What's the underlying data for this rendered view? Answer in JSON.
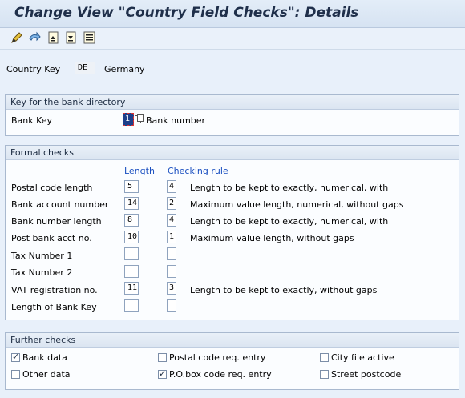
{
  "title": "Change View \"Country Field Checks\": Details",
  "toolbar": [
    {
      "icon": "edit-pen-icon"
    },
    {
      "icon": "other-entry-icon"
    },
    {
      "icon": "first-entry-icon"
    },
    {
      "icon": "previous-entry-icon"
    },
    {
      "icon": "next-entry-icon"
    }
  ],
  "country": {
    "label": "Country Key",
    "value": "DE",
    "name": "Germany"
  },
  "bank_directory": {
    "header": "Key for the bank directory",
    "bank_key_label": "Bank Key",
    "bank_key_value": "1",
    "bank_key_text": "Bank number"
  },
  "formal_checks": {
    "header": "Formal checks",
    "col_length": "Length",
    "col_rule": "Checking rule",
    "rows": [
      {
        "label": "Postal code length",
        "length": "5",
        "rule": "4",
        "desc": "Length to be kept to exactly, numerical, with"
      },
      {
        "label": "Bank account number",
        "length": "14",
        "rule": "2",
        "desc": "Maximum value length, numerical, without gaps"
      },
      {
        "label": "Bank number length",
        "length": "8",
        "rule": "4",
        "desc": "Length to be kept to exactly, numerical, with"
      },
      {
        "label": "Post bank acct no.",
        "length": "10",
        "rule": "1",
        "desc": "Maximum value length, without gaps"
      },
      {
        "label": "Tax Number 1",
        "length": "",
        "rule": "",
        "desc": ""
      },
      {
        "label": "Tax Number 2",
        "length": "",
        "rule": "",
        "desc": ""
      },
      {
        "label": "VAT registration no.",
        "length": "11",
        "rule": "3",
        "desc": "Length to be kept to exactly, without gaps"
      },
      {
        "label": "Length of Bank Key",
        "length": "",
        "rule": "",
        "desc": ""
      }
    ]
  },
  "further_checks": {
    "header": "Further checks",
    "items": [
      {
        "label": "Bank data",
        "checked": true
      },
      {
        "label": "Postal code req. entry",
        "checked": false
      },
      {
        "label": "City file active",
        "checked": false
      },
      {
        "label": "Other data",
        "checked": false
      },
      {
        "label": "P.O.box code req. entry",
        "checked": true
      },
      {
        "label": "Street postcode",
        "checked": false
      }
    ]
  }
}
